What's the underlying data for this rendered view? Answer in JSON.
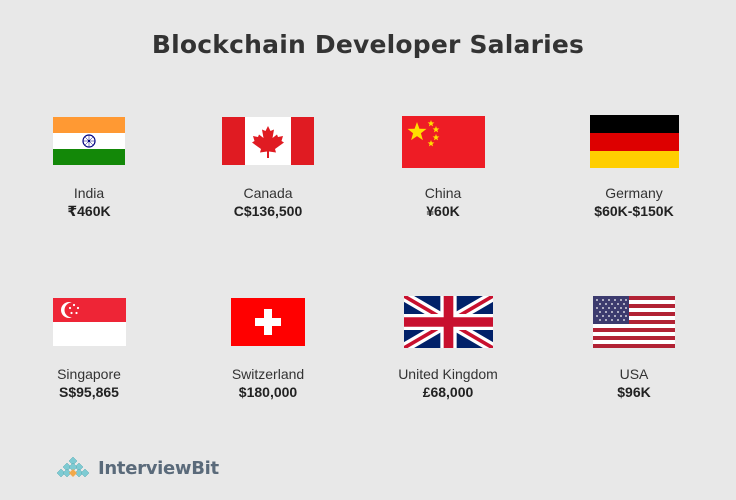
{
  "title": "Blockchain Developer Salaries",
  "countries": [
    {
      "name": "India",
      "salary": "₹460K",
      "flag": "india-flag"
    },
    {
      "name": "Canada",
      "salary": "C$136,500",
      "flag": "canada-flag"
    },
    {
      "name": "China",
      "salary": "¥60K",
      "flag": "china-flag"
    },
    {
      "name": "Germany",
      "salary": "$60K-$150K",
      "flag": "germany-flag"
    },
    {
      "name": "Singapore",
      "salary": "S$95,865",
      "flag": "singapore-flag"
    },
    {
      "name": "Switzerland",
      "salary": "$180,000",
      "flag": "switzerland-flag"
    },
    {
      "name": "United Kingdom",
      "salary": "£68,000",
      "flag": "uk-flag"
    },
    {
      "name": "USA",
      "salary": "$96K",
      "flag": "usa-flag"
    }
  ],
  "brand": {
    "name": "InterviewBit",
    "icon": "interviewbit-logo-icon"
  },
  "colors": {
    "background": "#e8e8e8",
    "text": "#333333"
  }
}
